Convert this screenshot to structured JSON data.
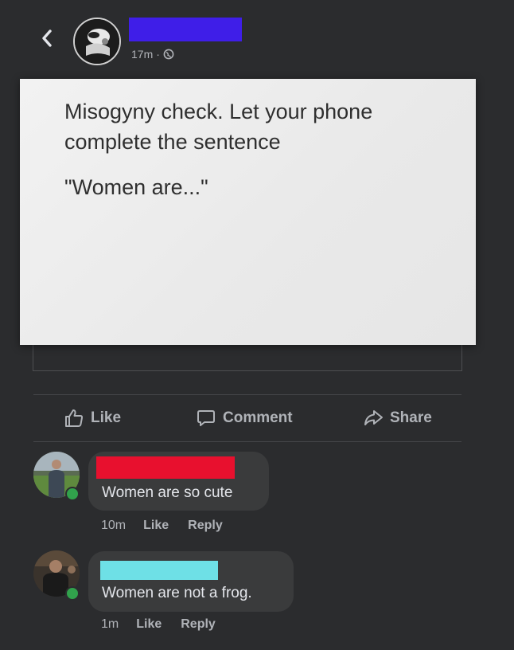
{
  "post": {
    "time": "17m",
    "separator": "·",
    "redaction_color": "#3f1ee8",
    "card_lines": [
      "Misogyny check. Let your phone complete the sentence",
      "\"Women are...\""
    ]
  },
  "actions": {
    "like": "Like",
    "comment": "Comment",
    "share": "Share"
  },
  "comments": [
    {
      "redaction_color": "#e8102e",
      "text": "Women are so cute",
      "time": "10m",
      "like": "Like",
      "reply": "Reply"
    },
    {
      "redaction_color": "#6ee0e6",
      "text": "Women are not a frog.",
      "time": "1m",
      "like": "Like",
      "reply": "Reply"
    }
  ],
  "icons": [
    "back-chevron-icon",
    "globe-icon",
    "like-thumb-icon",
    "comment-bubble-icon",
    "share-arrow-icon"
  ],
  "colors": {
    "background": "#2b2c2e",
    "bubble": "#3a3b3c",
    "online_dot": "#31a24c",
    "muted_text": "#b0b3b8"
  }
}
